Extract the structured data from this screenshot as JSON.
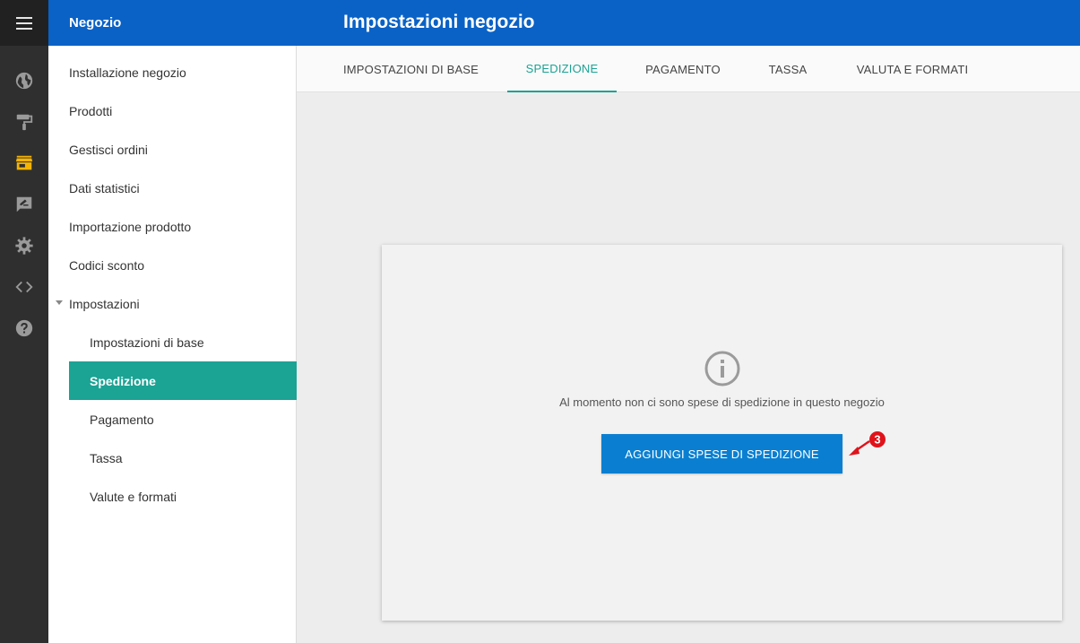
{
  "header": {
    "app_title": "Negozio",
    "page_title": "Impostazioni negozio"
  },
  "rail": {
    "items": [
      "menu-icon",
      "globe-icon",
      "paint-roller-icon",
      "store-icon",
      "feedback-icon",
      "gear-icon",
      "code-icon",
      "help-icon"
    ],
    "active_color": "#f5b400"
  },
  "sidebar": {
    "items": [
      {
        "label": "Installazione negozio"
      },
      {
        "label": "Prodotti"
      },
      {
        "label": "Gestisci ordini"
      },
      {
        "label": "Dati statistici"
      },
      {
        "label": "Importazione prodotto"
      },
      {
        "label": "Codici sconto"
      },
      {
        "label": "Impostazioni"
      }
    ],
    "settings_items": [
      {
        "label": "Impostazioni di base"
      },
      {
        "label": "Spedizione"
      },
      {
        "label": "Pagamento"
      },
      {
        "label": "Tassa"
      },
      {
        "label": "Valute e formati"
      }
    ]
  },
  "tabs": [
    {
      "label": "IMPOSTAZIONI DI BASE"
    },
    {
      "label": "SPEDIZIONE"
    },
    {
      "label": "PAGAMENTO"
    },
    {
      "label": "TASSA"
    },
    {
      "label": "VALUTA E FORMATI"
    }
  ],
  "main": {
    "empty_message": "Al momento non ci sono spese di spedizione in questo negozio",
    "add_button_label": "AGGIUNGI SPESE DI SPEDIZIONE"
  },
  "annotation": {
    "number": "3",
    "color": "#e0121a"
  },
  "colors": {
    "header": "#0a62c6",
    "accent": "#1ba394",
    "button": "#0a7fd1"
  }
}
